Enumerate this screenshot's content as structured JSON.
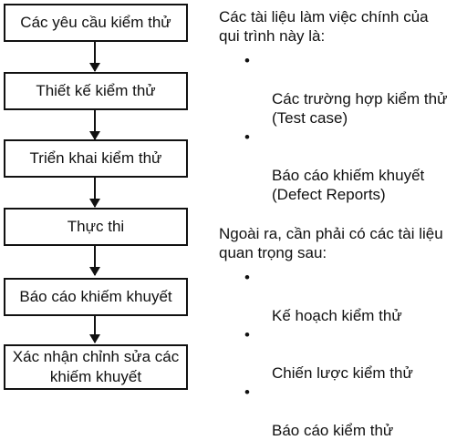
{
  "flowchart": {
    "steps": [
      "Các yêu cầu kiểm thử",
      "Thiết kế kiểm thử",
      "Triển khai kiểm thử",
      "Thực thi",
      "Báo cáo khiếm khuyết",
      "Xác nhận chỉnh sửa các khiếm khuyết"
    ]
  },
  "notes": {
    "intro": "Các tài liệu làm việc chính của\nqui trình này là:",
    "main_docs": [
      "Các trường hợp kiểm thử\n(Test case)",
      "Báo cáo khiếm khuyết\n(Defect Reports)"
    ],
    "extra_intro": "Ngoài ra, cần phải có các tài liệu\nquan trọng sau:",
    "extra_docs": [
      "Kế hoạch kiểm thử",
      "Chiến lược kiểm thử",
      "Báo cáo kiểm thử"
    ],
    "bullet": "•"
  }
}
